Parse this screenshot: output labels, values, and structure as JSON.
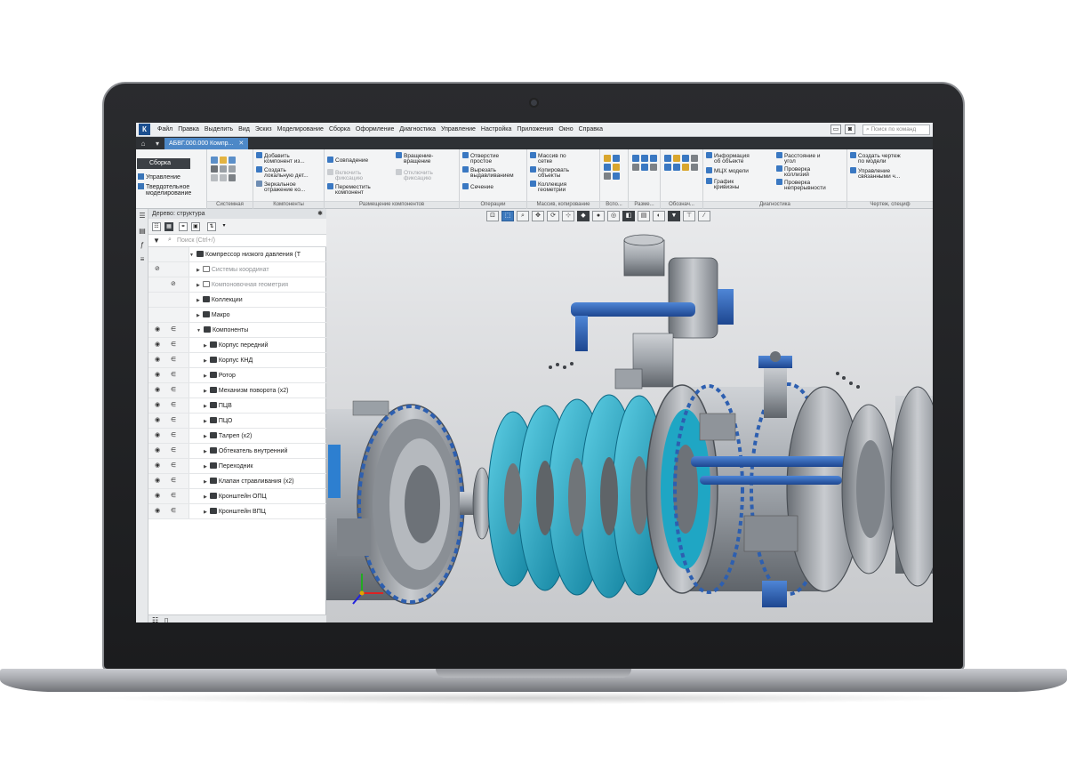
{
  "app": {
    "logo_glyph": "К",
    "menu": [
      "Файл",
      "Правка",
      "Выделить",
      "Вид",
      "Эскиз",
      "Моделирование",
      "Сборка",
      "Оформление",
      "Диагностика",
      "Управление",
      "Настройка",
      "Приложения",
      "Окно",
      "Справка"
    ],
    "command_search_placeholder": "Поиск по команд"
  },
  "tabs": {
    "home_glyph": "⌂",
    "document_title": "АБВГ.000.000 Компр...",
    "close_glyph": "✕"
  },
  "ribbon": {
    "mode": "Сборка",
    "left_items": [
      "Управление",
      "Твердотельное",
      "моделирование"
    ],
    "groups": {
      "system": {
        "label": "Системная"
      },
      "components": {
        "label": "Компоненты",
        "commands": [
          "Добавить",
          "компонент из...",
          "Создать",
          "локальную дет...",
          "Зеркальное",
          "отражение ко..."
        ]
      },
      "placement": {
        "label": "Размещение компонентов",
        "commands": [
          "Совпадение",
          "Вращение-",
          "вращение",
          "Включить",
          "фиксацию",
          "Отключить",
          "фиксацию",
          "Переместить",
          "компонент"
        ]
      },
      "operations": {
        "label": "Операции",
        "commands": [
          "Отверстие",
          "простое",
          "Вырезать",
          "выдавливанием",
          "Сечение"
        ]
      },
      "arrays": {
        "label": "Массив, копирование",
        "commands": [
          "Массив по",
          "сетке",
          "Копировать",
          "объекты",
          "Коллекция",
          "геометрии"
        ]
      },
      "aux": {
        "label": "Вспо..."
      },
      "sizes": {
        "label": "Разме..."
      },
      "notation": {
        "label": "Обознач..."
      },
      "diagnostics": {
        "label": "Диагностика",
        "commands": [
          "Информация",
          "об объекте",
          "МЦХ модели",
          "График",
          "кривизны",
          "Расстояние и",
          "угол",
          "Проверка",
          "коллизий",
          "Проверка",
          "непрерывности"
        ]
      },
      "drawing": {
        "label": "Чертеж, специф",
        "commands": [
          "Создать чертеж",
          "по модели",
          "Управление",
          "связанными ч..."
        ]
      }
    }
  },
  "tree_panel": {
    "title": "Дерево: структура",
    "pin_glyph": "✱",
    "search_placeholder": "Поиск (Ctrl+/)",
    "rows": [
      {
        "label": "Компрессор низкого давления (Т",
        "dim": false
      },
      {
        "label": "Системы координат",
        "dim": true
      },
      {
        "label": "Компоновочная геометрия",
        "dim": true
      },
      {
        "label": "Коллекции",
        "dim": false
      },
      {
        "label": "Макро",
        "dim": false
      },
      {
        "label": "Компоненты",
        "dim": false
      },
      {
        "label": "Корпус передний",
        "dim": false
      },
      {
        "label": "Корпус КНД",
        "dim": false
      },
      {
        "label": "Ротор",
        "dim": false
      },
      {
        "label": "Механизм поворота (x2)",
        "dim": false
      },
      {
        "label": "ПЦВ",
        "dim": false
      },
      {
        "label": "ПЦО",
        "dim": false
      },
      {
        "label": "Талреп (x2)",
        "dim": false
      },
      {
        "label": "Обтекатель внутренний",
        "dim": false
      },
      {
        "label": "Переходник",
        "dim": false
      },
      {
        "label": "Клапан стравливания (x2)",
        "dim": false
      },
      {
        "label": "Кронштейн ОПЦ",
        "dim": false
      },
      {
        "label": "Кронштейн ВПЦ",
        "dim": false
      }
    ]
  },
  "colors": {
    "accent": "#4d88c7",
    "blade": "#1aa3c2",
    "metal": "#9ea3a9",
    "blue_part": "#2d5fb0"
  }
}
